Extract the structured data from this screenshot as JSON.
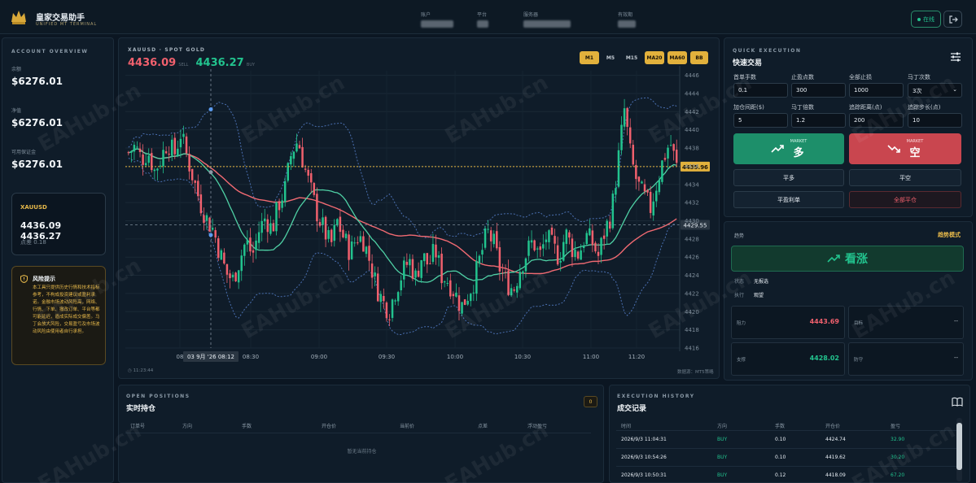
{
  "app": {
    "title": "皇家交易助手",
    "subtitle": "UNIFIED MT TERMINAL"
  },
  "header": {
    "fields": [
      {
        "label": "账户"
      },
      {
        "label": "平台"
      },
      {
        "label": "服务器"
      },
      {
        "label": "有效期"
      }
    ],
    "status_label": "在线"
  },
  "account": {
    "section_title": "ACCOUNT OVERVIEW",
    "balance_label": "余额",
    "balance": "$6276.01",
    "equity_label": "净值",
    "equity": "$6276.01",
    "free_margin_label": "可用保证金",
    "free_margin": "$6276.01",
    "quote": {
      "symbol": "XAUUSD",
      "bid": "4436.09",
      "ask": "4436.27",
      "spread_label": "点差",
      "spread": "0.18"
    },
    "risk": {
      "title": "风险提示",
      "text": "本工具只提供历史行情和技术指标参考，不构成投资建议或盈利承诺。金融市场波动风险高，网络、行情、下单、撤改订单、平台等都可能延迟，造成实际成交偏差。马丁会放大风险，交易盈亏及市场波动风险由使用者自行承担。"
    }
  },
  "chart": {
    "symbol_title": "XAUUSD · SPOT GOLD",
    "bid": "4436.09",
    "bid_tag": "SELL",
    "ask": "4436.27",
    "ask_tag": "BUY",
    "timeframes": [
      {
        "label": "M1",
        "active": true
      },
      {
        "label": "M5",
        "active": false
      },
      {
        "label": "M15",
        "active": false
      },
      {
        "label": "MA20",
        "active": true
      },
      {
        "label": "MA60",
        "active": true
      },
      {
        "label": "BB",
        "active": true
      }
    ],
    "price_line_label": "4435.96",
    "crosshair_price_label": "4429.55",
    "crosshair_time_label": "03 9月 '26   08:12",
    "footer_time": "11:23:44",
    "footer_right": "数据源：MT5策略",
    "watermark": "EAHub.cn"
  },
  "chart_data": {
    "type": "candlestick",
    "y_ticks": [
      4446,
      4444,
      4442,
      4440,
      4438,
      4436,
      4434,
      4432,
      4430,
      4428,
      4426,
      4424,
      4422,
      4420,
      4418,
      4416
    ],
    "ylim": [
      4416,
      4446.5
    ],
    "x_ticks": [
      "08",
      "08:30",
      "09:00",
      "09:30",
      "10:00",
      "10:30",
      "11:00",
      "11:20"
    ],
    "series": [
      {
        "name": "MA20",
        "color": "#4fd1a5"
      },
      {
        "name": "MA60",
        "color": "#f06a72"
      },
      {
        "name": "BB",
        "color": "#4a6fb0"
      }
    ],
    "price_line": 4435.96,
    "crosshair_price": 4429.55,
    "path": [
      4437.5,
      4438.2,
      4436.8,
      4437.6,
      4435.5,
      4436.9,
      4438.8,
      4437.2,
      4439.6,
      4437.0,
      4434.5,
      4432.0,
      4430.2,
      4429.0,
      4426.5,
      4424.2,
      4423.5,
      4425.6,
      4427.8,
      4426.2,
      4428.9,
      4430.4,
      4429.0,
      4431.8,
      4433.5,
      4437.6,
      4438.9,
      4435.8,
      4433.2,
      4430.6,
      4428.9,
      4427.2,
      4429.9,
      4428.1,
      4426.5,
      4428.3,
      4427.9,
      4425.5,
      4422.8,
      4421.0,
      4420.2,
      4422.6,
      4424.3,
      4425.7,
      4423.8,
      4426.2,
      4425.1,
      4426.8,
      4424.0,
      4423.4,
      4422.1,
      4420.5,
      4421.9,
      4423.5,
      4426.2,
      4428.8,
      4427.4,
      4424.5,
      4423.2,
      4422.4,
      4424.8,
      4426.5,
      4427.8,
      4426.0,
      4428.2,
      4427.1,
      4426.0,
      4428.6,
      4427.0,
      4426.3,
      4428.4,
      4427.7,
      4426.1,
      4428.9,
      4430.8,
      4436.4,
      4442.2,
      4436.8,
      4434.0,
      4432.6,
      4431.4,
      4434.3,
      4436.9,
      4438.7,
      4435.9
    ]
  },
  "exec": {
    "section_title": "QUICK EXECUTION",
    "title": "快速交易",
    "fields": [
      {
        "label": "首单手数",
        "value": "0.1"
      },
      {
        "label": "止盈点数",
        "value": "300"
      },
      {
        "label": "全部止损",
        "value": "1000"
      },
      {
        "label": "马丁次数",
        "value": "3次"
      },
      {
        "label": "加仓间距($)",
        "value": "5"
      },
      {
        "label": "马丁倍数",
        "value": "1.2"
      },
      {
        "label": "追踪距离(点)",
        "value": "200"
      },
      {
        "label": "追踪步长(点)",
        "value": "10"
      }
    ],
    "buy": {
      "tag": "MARKET",
      "label": "多"
    },
    "sell": {
      "tag": "MARKET",
      "label": "空"
    },
    "close_long": "平多",
    "close_short": "平空",
    "close_profit": "平盈利单",
    "close_all": "全部平仓"
  },
  "trend": {
    "title": "趋势",
    "mode": "趋势模式",
    "signal": "看涨",
    "status_label": "状态",
    "status_value": "无报选",
    "exec_label": "执行",
    "exec_value": "观望",
    "resistance_label": "阻力",
    "resistance": "4443.69",
    "target_label": "目标",
    "target": "--",
    "support_label": "支撑",
    "support": "4428.02",
    "extra_label": "防守",
    "extra": "--"
  },
  "positions": {
    "section_title": "OPEN POSITIONS",
    "title": "实时持仓",
    "count": "0",
    "columns": [
      "订单号",
      "方向",
      "手数",
      "开仓价",
      "当前价",
      "点差",
      "浮动盈亏"
    ],
    "empty": "暂无当前持仓"
  },
  "history": {
    "section_title": "EXECUTION HISTORY",
    "title": "成交记录",
    "columns": [
      "时间",
      "方向",
      "手数",
      "开仓价",
      "盈亏"
    ],
    "rows": [
      {
        "time": "2026/9/3 11:04:31",
        "side": "BUY",
        "lots": "0.10",
        "price": "4424.74",
        "pnl": "32.90"
      },
      {
        "time": "2026/9/3 10:54:26",
        "side": "BUY",
        "lots": "0.10",
        "price": "4419.62",
        "pnl": "30.20"
      },
      {
        "time": "2026/9/3 10:50:31",
        "side": "BUY",
        "lots": "0.12",
        "price": "4418.09",
        "pnl": "67.20"
      }
    ]
  }
}
